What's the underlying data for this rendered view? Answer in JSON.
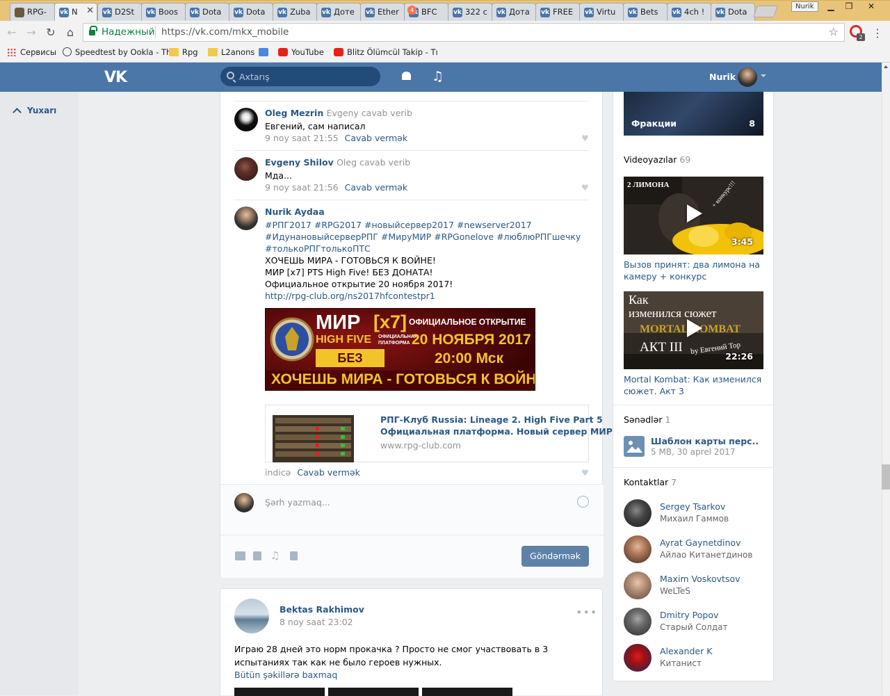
{
  "browser": {
    "tabs": [
      {
        "label": "RPG-",
        "icon": "rpg-club-favicon"
      },
      {
        "label": "N",
        "icon": "vk-icon",
        "active": true
      },
      {
        "label": "D2St",
        "icon": "vk-icon"
      },
      {
        "label": "Boos",
        "icon": "vk-icon"
      },
      {
        "label": "Dota",
        "icon": "vk-icon"
      },
      {
        "label": "Dota",
        "icon": "vk-icon"
      },
      {
        "label": "Zuba",
        "icon": "vk-icon"
      },
      {
        "label": "Доте",
        "icon": "vk-icon"
      },
      {
        "label": "Ether",
        "icon": "vk-icon"
      },
      {
        "label": "BFC",
        "icon": "vk-icon"
      },
      {
        "label": "322 с",
        "icon": "vk-icon"
      },
      {
        "label": "Дота",
        "icon": "vk-icon"
      },
      {
        "label": "FREE",
        "icon": "vk-icon"
      },
      {
        "label": "Virtu",
        "icon": "vk-icon"
      },
      {
        "label": "Bets",
        "icon": "vk-icon"
      },
      {
        "label": "4ch !",
        "icon": "vk-icon"
      },
      {
        "label": "Dota",
        "icon": "vk-icon"
      }
    ],
    "user_chip": "Nurik",
    "secure_label": "Надежный",
    "url": "https://vk.com/mkx_mobile",
    "opera_badge": "2",
    "bookmarks": [
      {
        "label": "Сервисы",
        "icon": "apps-icon"
      },
      {
        "label": "Speedtest by Ookla - Th",
        "icon": "speedtest-icon"
      },
      {
        "label": "Rpg",
        "icon": "folder-icon"
      },
      {
        "label": "L2anons",
        "icon": "folder-icon"
      },
      {
        "label": "",
        "icon": "translate-icon"
      },
      {
        "label": "YouTube",
        "icon": "youtube-icon"
      },
      {
        "label": "Blitz Ölümcül Takip - Tı",
        "icon": "youtube-icon"
      }
    ]
  },
  "vk": {
    "logo": "VK",
    "search_placeholder": "Axtarış",
    "notifications_count": "4",
    "username": "Nurik",
    "up_label": "Yuxarı",
    "comments": [
      {
        "author": "Oleg Mezrin",
        "reply_to": "Evgeny cavab verib",
        "text": "Евгений, сам написал",
        "date": "9 noy saat 21:55",
        "reply": "Cavab vermək"
      },
      {
        "author": "Evgeny Shilov",
        "reply_to": "Oleg cavab verib",
        "text": "Мда...",
        "date": "9 noy saat 21:56",
        "reply": "Cavab vermək"
      }
    ],
    "nurik_comment": {
      "author": "Nurik Aydaa",
      "tags_line1": "#РПГ2017 #RPG2017 #новыйсервер2017 #newserver2017",
      "tags_line2": "#ИдунановыйсерверРПГ #МируМИР #RPGonelove #люблюРПГшечку",
      "tags_line3": "#толькоРПГтолькоПТС",
      "line1": "ХОЧЕШЬ МИРА - ГОТОВЬСЯ К ВОЙНЕ!",
      "line2": "МИР [x7] PTS High Five! БЕЗ ДОНАТА!",
      "line3": "Официальное открытие 20 ноября 2017!",
      "link": "http://rpg-club.org/ns2017hfcontestpr1",
      "date": "indicə",
      "reply": "Cavab vermək"
    },
    "banner": {
      "mir": "МИР",
      "x7": "[x7]",
      "open": "ОФИЦИАЛЬНОЕ ОТКРЫТИЕ",
      "high_five": "HIGH FIVE",
      "platform1": "ОФИЦИАЛЬНАЯ",
      "platform2": "ПЛАТФОРМА",
      "date": "20 НОЯБРЯ 2017",
      "time": "20:00 Мск",
      "no_donate": "БЕЗ ДОНАТА",
      "slogan": "ХОЧЕШЬ МИРА - ГОТОВЬСЯ К ВОЙНЕ"
    },
    "link_card": {
      "title1": "РПГ-Клуб Russia: Lineage 2. High Five Part 5",
      "title2": "Официальная платформа. Новый сервер МИР!",
      "host": "www.rpg-club.com"
    },
    "composer": {
      "placeholder": "Şərh yazmaq...",
      "send": "Göndərmək"
    },
    "post2": {
      "author": "Bektas Rakhimov",
      "date": "8 noy saat 23:02",
      "text": "Играю 28 дней это норм прокачка ? Просто не смог участвовать в 3 испытаниях так как не было героев нужных.",
      "more": "Bütün şəkillərə baxmaq"
    },
    "sidebar": {
      "fractions_label": "Фракции",
      "fractions_count": "8",
      "videos_title": "Videoyazılar",
      "videos_count": "69",
      "videos": [
        {
          "title": "Вызов принят: два лимона на камеру + конкурс",
          "duration": "3:45",
          "overlay1": "2 ЛИМОНА",
          "overlay2": "+ конкурс!!!"
        },
        {
          "title": "Mortal Kombat: Как изменился сюжет. Акт 3",
          "duration": "22:26",
          "overlay1": "Как",
          "overlay2": "изменился сюжет",
          "overlay3": "MORTAL KOMBAT",
          "overlay4": "АКТ III",
          "overlay5": "by Евгений Тор"
        }
      ],
      "docs_title": "Sənədlər",
      "docs_count": "1",
      "doc": {
        "name": "Шаблон карты перс..",
        "meta": "5 MB, 30 aprel 2017"
      },
      "contacts_title": "Kontaktlar",
      "contacts_count": "7",
      "contacts": [
        {
          "name": "Sergey Tsarkov",
          "sub": "Михаил Гаммов"
        },
        {
          "name": "Ayrat Gaynetdinov",
          "sub": "Айлао Китанетдинов"
        },
        {
          "name": "Maxim Voskovtsov",
          "sub": "WeLTeS"
        },
        {
          "name": "Dmitry Popov",
          "sub": "Старый Солдат"
        },
        {
          "name": "Alexander K",
          "sub": "Китанист"
        }
      ]
    }
  }
}
